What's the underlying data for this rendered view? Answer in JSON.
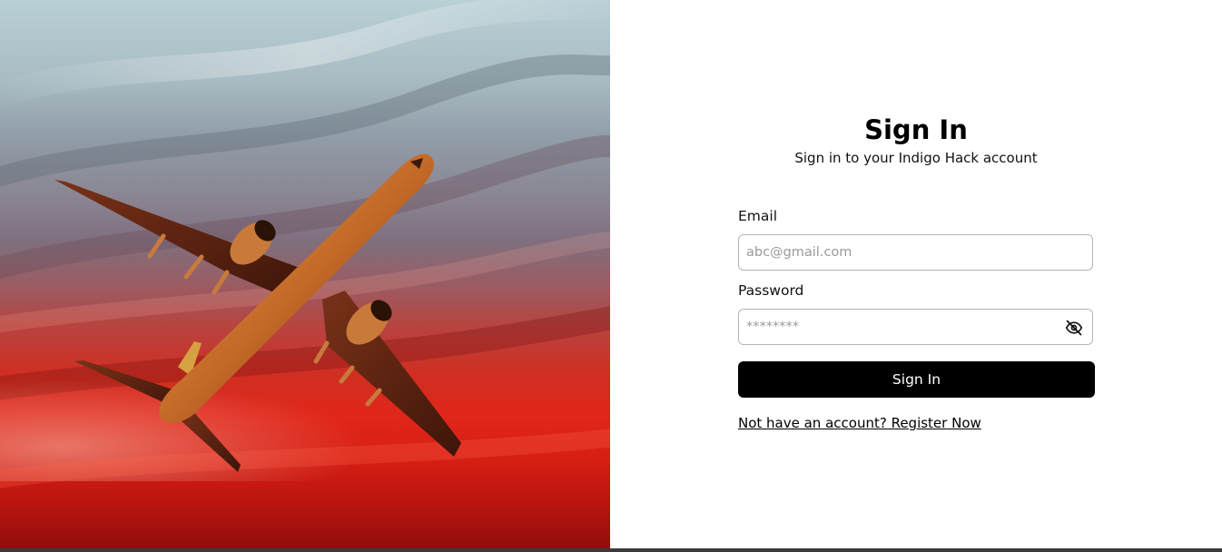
{
  "hero": {
    "image_alt": "Airplane flying through a red sunset sky"
  },
  "signin": {
    "title": "Sign In",
    "subtitle": "Sign in to your Indigo Hack account",
    "email_label": "Email",
    "email_placeholder": "abc@gmail.com",
    "email_value": "",
    "password_label": "Password",
    "password_placeholder": "********",
    "password_value": "",
    "password_toggle_icon": "eye-off-icon",
    "submit_label": "Sign In",
    "register_link": "Not have an account? Register Now"
  },
  "colors": {
    "button_bg": "#000000",
    "button_text": "#ffffff",
    "input_border": "#b5b5b5"
  }
}
